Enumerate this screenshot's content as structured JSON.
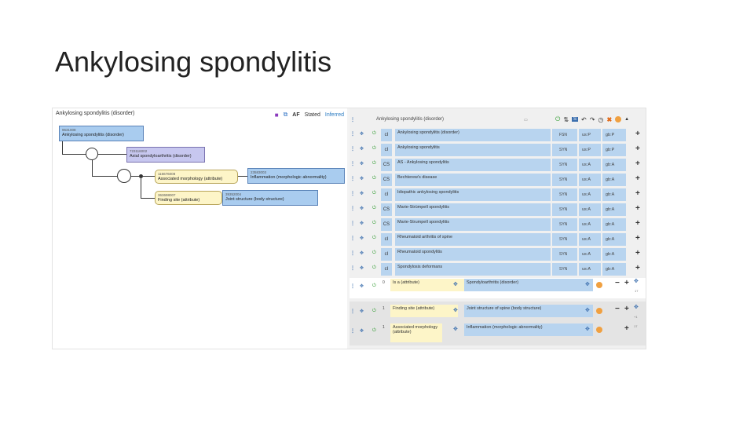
{
  "slide": {
    "title": "Ankylosing spondylitis"
  },
  "diagram": {
    "header": "Ankylosing spondylitis (disorder)",
    "toolbar": {
      "af": "AF",
      "stated": "Stated",
      "inferred": "Inferred"
    },
    "focus": {
      "sctid": "9631008",
      "label": "Ankylosing spondylitis (disorder)"
    },
    "parent": {
      "sctid": "723116002",
      "label": "Axial spondyloarthritis (disorder)"
    },
    "attr1": {
      "sctid": "116676008",
      "label": "Associated morphology (attribute)"
    },
    "value1": {
      "sctid": "23583003",
      "label": "Inflammation (morphologic abnormality)"
    },
    "attr2": {
      "sctid": "363698007",
      "label": "Finding site (attribute)"
    },
    "value2": {
      "sctid": "39352004",
      "label": "Joint structure (body structure)"
    }
  },
  "grid": {
    "header": "Ankylosing spondylitis (disorder)",
    "descriptions": [
      {
        "cs": "cI",
        "term": "Ankylosing spondylitis (disorder)",
        "type": "FSN",
        "ac1": "us:P",
        "ac2": "gb:P"
      },
      {
        "cs": "cI",
        "term": "Ankylosing spondylitis",
        "type": "SYN",
        "ac1": "us:P",
        "ac2": "gb:P"
      },
      {
        "cs": "CS",
        "term": "AS - Ankylosing spondylitis",
        "type": "SYN",
        "ac1": "us:A",
        "ac2": "gb:A"
      },
      {
        "cs": "CS",
        "term": "Bechterew's disease",
        "type": "SYN",
        "ac1": "us:A",
        "ac2": "gb:A"
      },
      {
        "cs": "cI",
        "term": "Idiopathic ankylosing spondylitis",
        "type": "SYN",
        "ac1": "us:A",
        "ac2": "gb:A"
      },
      {
        "cs": "CS",
        "term": "Marie-Strümpell spondylitis",
        "type": "SYN",
        "ac1": "us:A",
        "ac2": "gb:A"
      },
      {
        "cs": "CS",
        "term": "Marie-Strumpell spondylitis",
        "type": "SYN",
        "ac1": "us:A",
        "ac2": "gb:A"
      },
      {
        "cs": "cI",
        "term": "Rheumatoid arthritis of spine",
        "type": "SYN",
        "ac1": "us:A",
        "ac2": "gb:A"
      },
      {
        "cs": "cI",
        "term": "Rheumatoid spondylitis",
        "type": "SYN",
        "ac1": "us:A",
        "ac2": "gb:A"
      },
      {
        "cs": "cI",
        "term": "Spondylosis deformans",
        "type": "SYN",
        "ac1": "us:A",
        "ac2": "gb:A"
      }
    ],
    "isa": {
      "group": "0",
      "type": "Is a (attribute)",
      "dest": "Spondyloarthritis (disorder)",
      "meta": "17"
    },
    "group": [
      {
        "group": "1",
        "type": "Finding site (attribute)",
        "dest": "Joint structure of spine (body structure)",
        "meta": "+1"
      },
      {
        "group": "1",
        "type": "Associated morphology (attribute)",
        "dest": "Inflammation (morphologic abnormality)",
        "meta": "17"
      }
    ]
  }
}
